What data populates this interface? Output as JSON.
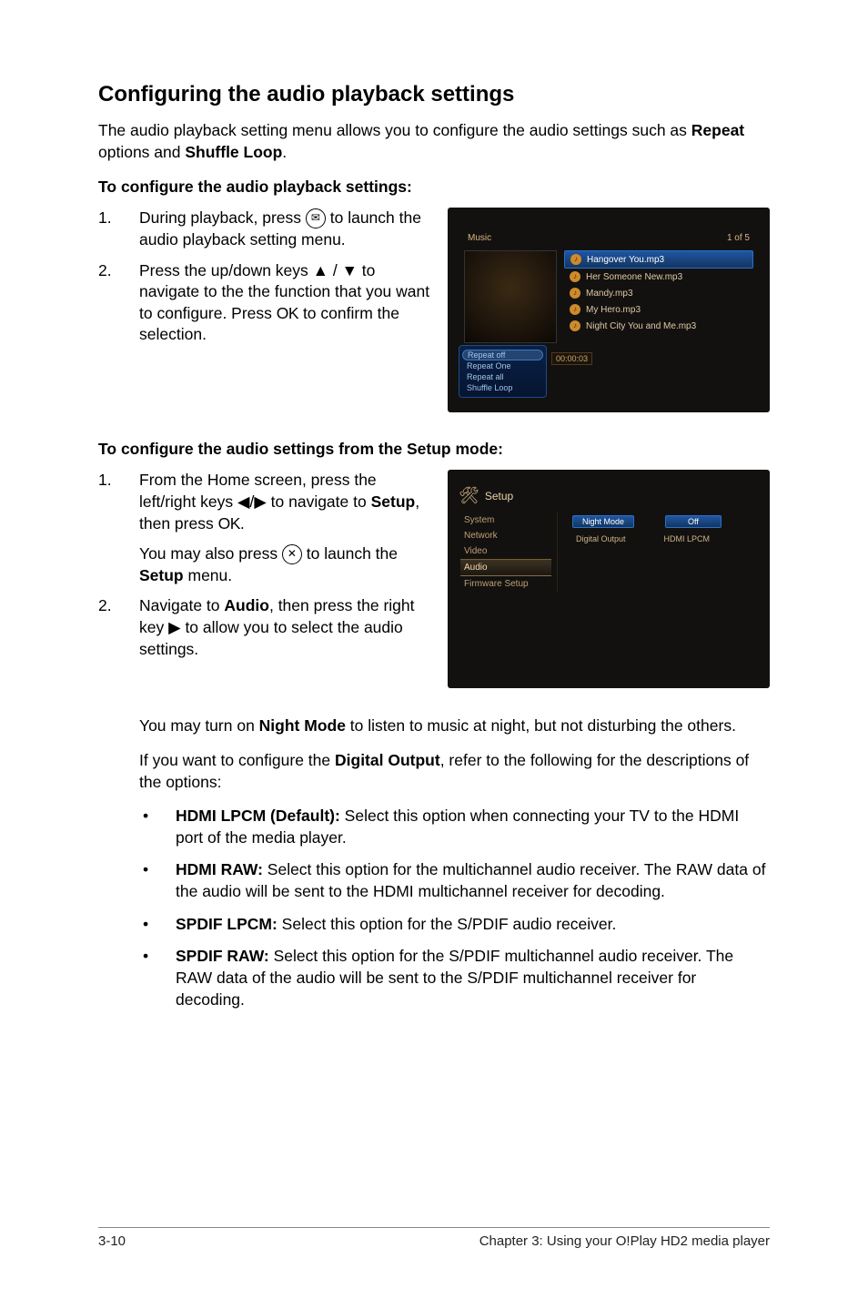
{
  "section": {
    "title": "Configuring the audio playback settings",
    "intro_pre": "The audio playback setting menu allows you to configure the audio settings such as ",
    "intro_bold1": "Repeat",
    "intro_mid": " options and ",
    "intro_bold2": "Shuffle Loop",
    "intro_post": "."
  },
  "sub1": "To configure the audio playback settings:",
  "steps1": {
    "s1_num": "1.",
    "s1_txt": "During playback, press      to launch the audio playback setting menu.",
    "s1_pre": "During playback, press ",
    "s1_post": " to launch the audio playback setting menu.",
    "s2_num": "2.",
    "s2_pre": "Press the up/down keys ",
    "s2_mid": " to navigate to the the function that you want to configure. Press ",
    "s2_post": " to confirm the selection."
  },
  "shot1": {
    "header_left": "Music",
    "header_right": "1 of 5",
    "thumb_caption": "Hangover You.mp3",
    "list": [
      "Hangover You.mp3",
      "Her Someone New.mp3",
      "Mandy.mp3",
      "My Hero.mp3",
      "Night City You and Me.mp3"
    ],
    "repeat": [
      "Repeat off",
      "Repeat One",
      "Repeat all",
      "Shuffle Loop"
    ],
    "time": "00:00:03"
  },
  "sub2": "To configure the audio settings from the Setup mode:",
  "steps2": {
    "s1_num": "1.",
    "s1_pre": "From the Home screen, press the left/right keys ",
    "s1_mid": " to navigate to ",
    "s1_bold": "Setup",
    "s1_mid2": ", then press ",
    "s1_post": ".",
    "note_pre": "You may also press ",
    "note_mid": " to launch the ",
    "note_bold": "Setup",
    "note_post": " menu.",
    "s2_num": "2.",
    "s2_pre": "Navigate to ",
    "s2_bold": "Audio",
    "s2_mid": ", then press the right key ",
    "s2_post": " to allow you to select the audio settings."
  },
  "shot2": {
    "title": "Setup",
    "left": [
      "System",
      "Network",
      "Video",
      "Audio",
      "Firmware Setup"
    ],
    "right": [
      {
        "lbl": "Night Mode",
        "val": "Off"
      },
      {
        "lbl": "Digital Output",
        "val": "HDMI LPCM"
      }
    ]
  },
  "lower": {
    "p1_pre": "You may turn on ",
    "p1_bold": "Night Mode",
    "p1_post": " to listen to music at night, but not disturbing the others.",
    "p2_pre": "If you want to configure the ",
    "p2_bold": "Digital Output",
    "p2_post": ", refer to the following for the descriptions of the options:",
    "opts": [
      {
        "b": "HDMI LPCM (Default):",
        "t": " Select this option when connecting your TV to the HDMI port of the media player."
      },
      {
        "b": "HDMI RAW:",
        "t": " Select this option for the multichannel audio receiver. The RAW data of the audio will be sent to the HDMI multichannel receiver for decoding."
      },
      {
        "b": "SPDIF LPCM:",
        "t": " Select this option for the S/PDIF audio receiver."
      },
      {
        "b": "SPDIF RAW:",
        "t": " Select this option for the S/PDIF multichannel audio receiver. The RAW data of the audio will be sent to the S/PDIF multichannel receiver for decoding."
      }
    ]
  },
  "footer": {
    "left": "3-10",
    "right": "Chapter 3: Using your O!Play HD2 media player"
  },
  "glyphs": {
    "up": "▲",
    "down": "▼",
    "left": "◀",
    "right": "▶",
    "slash": " / ",
    "bullet": "•"
  }
}
